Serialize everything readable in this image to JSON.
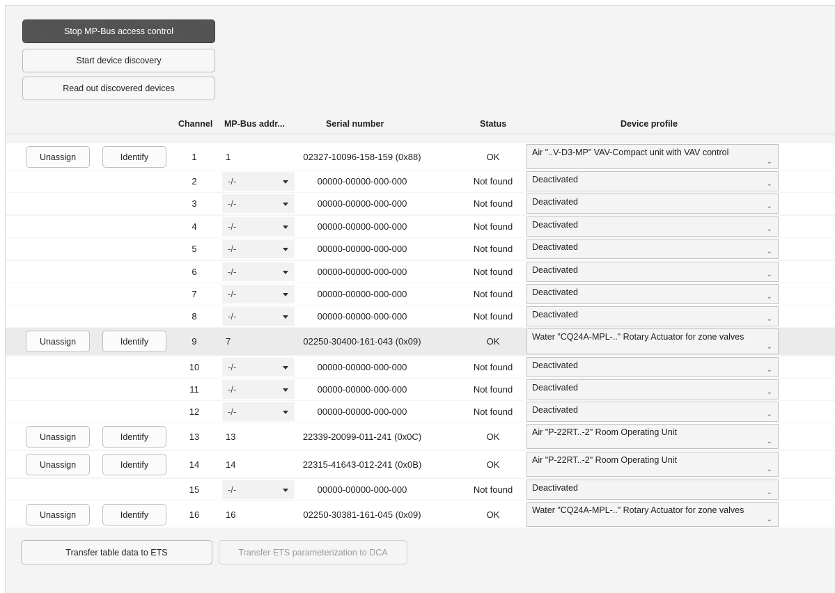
{
  "toolbar": {
    "stop_mpbus": "Stop MP-Bus access control",
    "start_discovery": "Start device discovery",
    "read_out": "Read out discovered devices"
  },
  "table": {
    "headers": {
      "channel": "Channel",
      "mpbus_addr": "MP-Bus addr...",
      "serial": "Serial number",
      "status": "Status",
      "profile": "Device profile"
    },
    "unassign_label": "Unassign",
    "identify_label": "Identify",
    "rows": [
      {
        "channel": "1",
        "addr": "1",
        "serial": "02327-10096-158-159 (0x88)",
        "status": "OK",
        "profile": "Air \"..V-D3-MP\" VAV-Compact unit with VAV control",
        "assigned": true
      },
      {
        "channel": "2",
        "addr": "-/-",
        "serial": "00000-00000-000-000",
        "status": "Not found",
        "profile": "Deactivated",
        "assigned": false
      },
      {
        "channel": "3",
        "addr": "-/-",
        "serial": "00000-00000-000-000",
        "status": "Not found",
        "profile": "Deactivated",
        "assigned": false
      },
      {
        "channel": "4",
        "addr": "-/-",
        "serial": "00000-00000-000-000",
        "status": "Not found",
        "profile": "Deactivated",
        "assigned": false
      },
      {
        "channel": "5",
        "addr": "-/-",
        "serial": "00000-00000-000-000",
        "status": "Not found",
        "profile": "Deactivated",
        "assigned": false
      },
      {
        "channel": "6",
        "addr": "-/-",
        "serial": "00000-00000-000-000",
        "status": "Not found",
        "profile": "Deactivated",
        "assigned": false
      },
      {
        "channel": "7",
        "addr": "-/-",
        "serial": "00000-00000-000-000",
        "status": "Not found",
        "profile": "Deactivated",
        "assigned": false
      },
      {
        "channel": "8",
        "addr": "-/-",
        "serial": "00000-00000-000-000",
        "status": "Not found",
        "profile": "Deactivated",
        "assigned": false
      },
      {
        "channel": "9",
        "addr": "7",
        "serial": "02250-30400-161-043 (0x09)",
        "status": "OK",
        "profile": "Water \"CQ24A-MPL-..\" Rotary Actuator for zone valves",
        "assigned": true,
        "selected": true
      },
      {
        "channel": "10",
        "addr": "-/-",
        "serial": "00000-00000-000-000",
        "status": "Not found",
        "profile": "Deactivated",
        "assigned": false
      },
      {
        "channel": "11",
        "addr": "-/-",
        "serial": "00000-00000-000-000",
        "status": "Not found",
        "profile": "Deactivated",
        "assigned": false
      },
      {
        "channel": "12",
        "addr": "-/-",
        "serial": "00000-00000-000-000",
        "status": "Not found",
        "profile": "Deactivated",
        "assigned": false
      },
      {
        "channel": "13",
        "addr": "13",
        "serial": "22339-20099-011-241 (0x0C)",
        "status": "OK",
        "profile": "Air \"P-22RT..-2\" Room Operating Unit",
        "assigned": true
      },
      {
        "channel": "14",
        "addr": "14",
        "serial": "22315-41643-012-241 (0x0B)",
        "status": "OK",
        "profile": "Air \"P-22RT..-2\" Room Operating Unit",
        "assigned": true
      },
      {
        "channel": "15",
        "addr": "-/-",
        "serial": "00000-00000-000-000",
        "status": "Not found",
        "profile": "Deactivated",
        "assigned": false
      },
      {
        "channel": "16",
        "addr": "16",
        "serial": "02250-30381-161-045 (0x09)",
        "status": "OK",
        "profile": "Water \"CQ24A-MPL-..\" Rotary Actuator for zone valves",
        "assigned": true
      }
    ]
  },
  "footer": {
    "transfer_table": "Transfer table data to ETS",
    "transfer_ets": "Transfer ETS parameterization to DCA"
  },
  "icons": {
    "profile_dropdown": "chevron-down-icon",
    "addr_dropdown": "caret-down-icon"
  }
}
